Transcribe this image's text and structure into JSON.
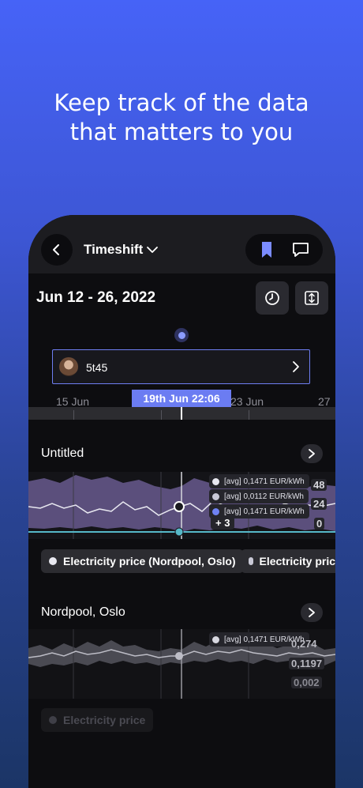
{
  "headline": {
    "line1": "Keep track of the data",
    "line2": "that matters to you"
  },
  "nav": {
    "title": "Timeshift",
    "back_icon": "chevron-left-icon",
    "title_icon": "chevron-down-icon",
    "bookmark_icon": "bookmark-icon",
    "comment_icon": "comment-icon",
    "accent": "#7b8cff"
  },
  "date_range": "Jun 12 - 26, 2022",
  "toolbar": {
    "history_icon": "clock-icon",
    "resize_icon": "vertical-resize-icon"
  },
  "note": {
    "text": "5t45",
    "avatar_icon": "avatar",
    "chevron_icon": "chevron-right-icon"
  },
  "timeline": {
    "labels": [
      "15 Jun",
      "23 Jun",
      "27"
    ],
    "selected": "19th Jun 22:06",
    "selected_color": "#6b7cf2"
  },
  "panel1": {
    "title": "Untitled",
    "tooltips": [
      {
        "text": "[avg] 0,1471 EUR/kWh",
        "color": "#e8e8f0"
      },
      {
        "text": "[avg] 0,0112 EUR/kWh",
        "color": "#c9c9d6"
      },
      {
        "text": "[avg] 0,1471 EUR/kWh",
        "color": "#6f82f2"
      }
    ],
    "more": "+ 3",
    "y_values": [
      "48",
      "24",
      "0"
    ],
    "chips": [
      {
        "label": "Electricity price (Nordpool, Oslo)",
        "color": "#e8e8f0"
      },
      {
        "label": "Electricity pric",
        "color": "#c9c9d6"
      }
    ]
  },
  "panel2": {
    "title": "Nordpool, Oslo",
    "tooltip": "[avg] 0,1471 EUR/kWh",
    "y_values": [
      "0,274",
      "0,1197",
      "0,002"
    ],
    "chip": "Electricity price"
  },
  "colors": {
    "area_fill": "#5b4f7c",
    "teal_line": "#56b8c8"
  }
}
